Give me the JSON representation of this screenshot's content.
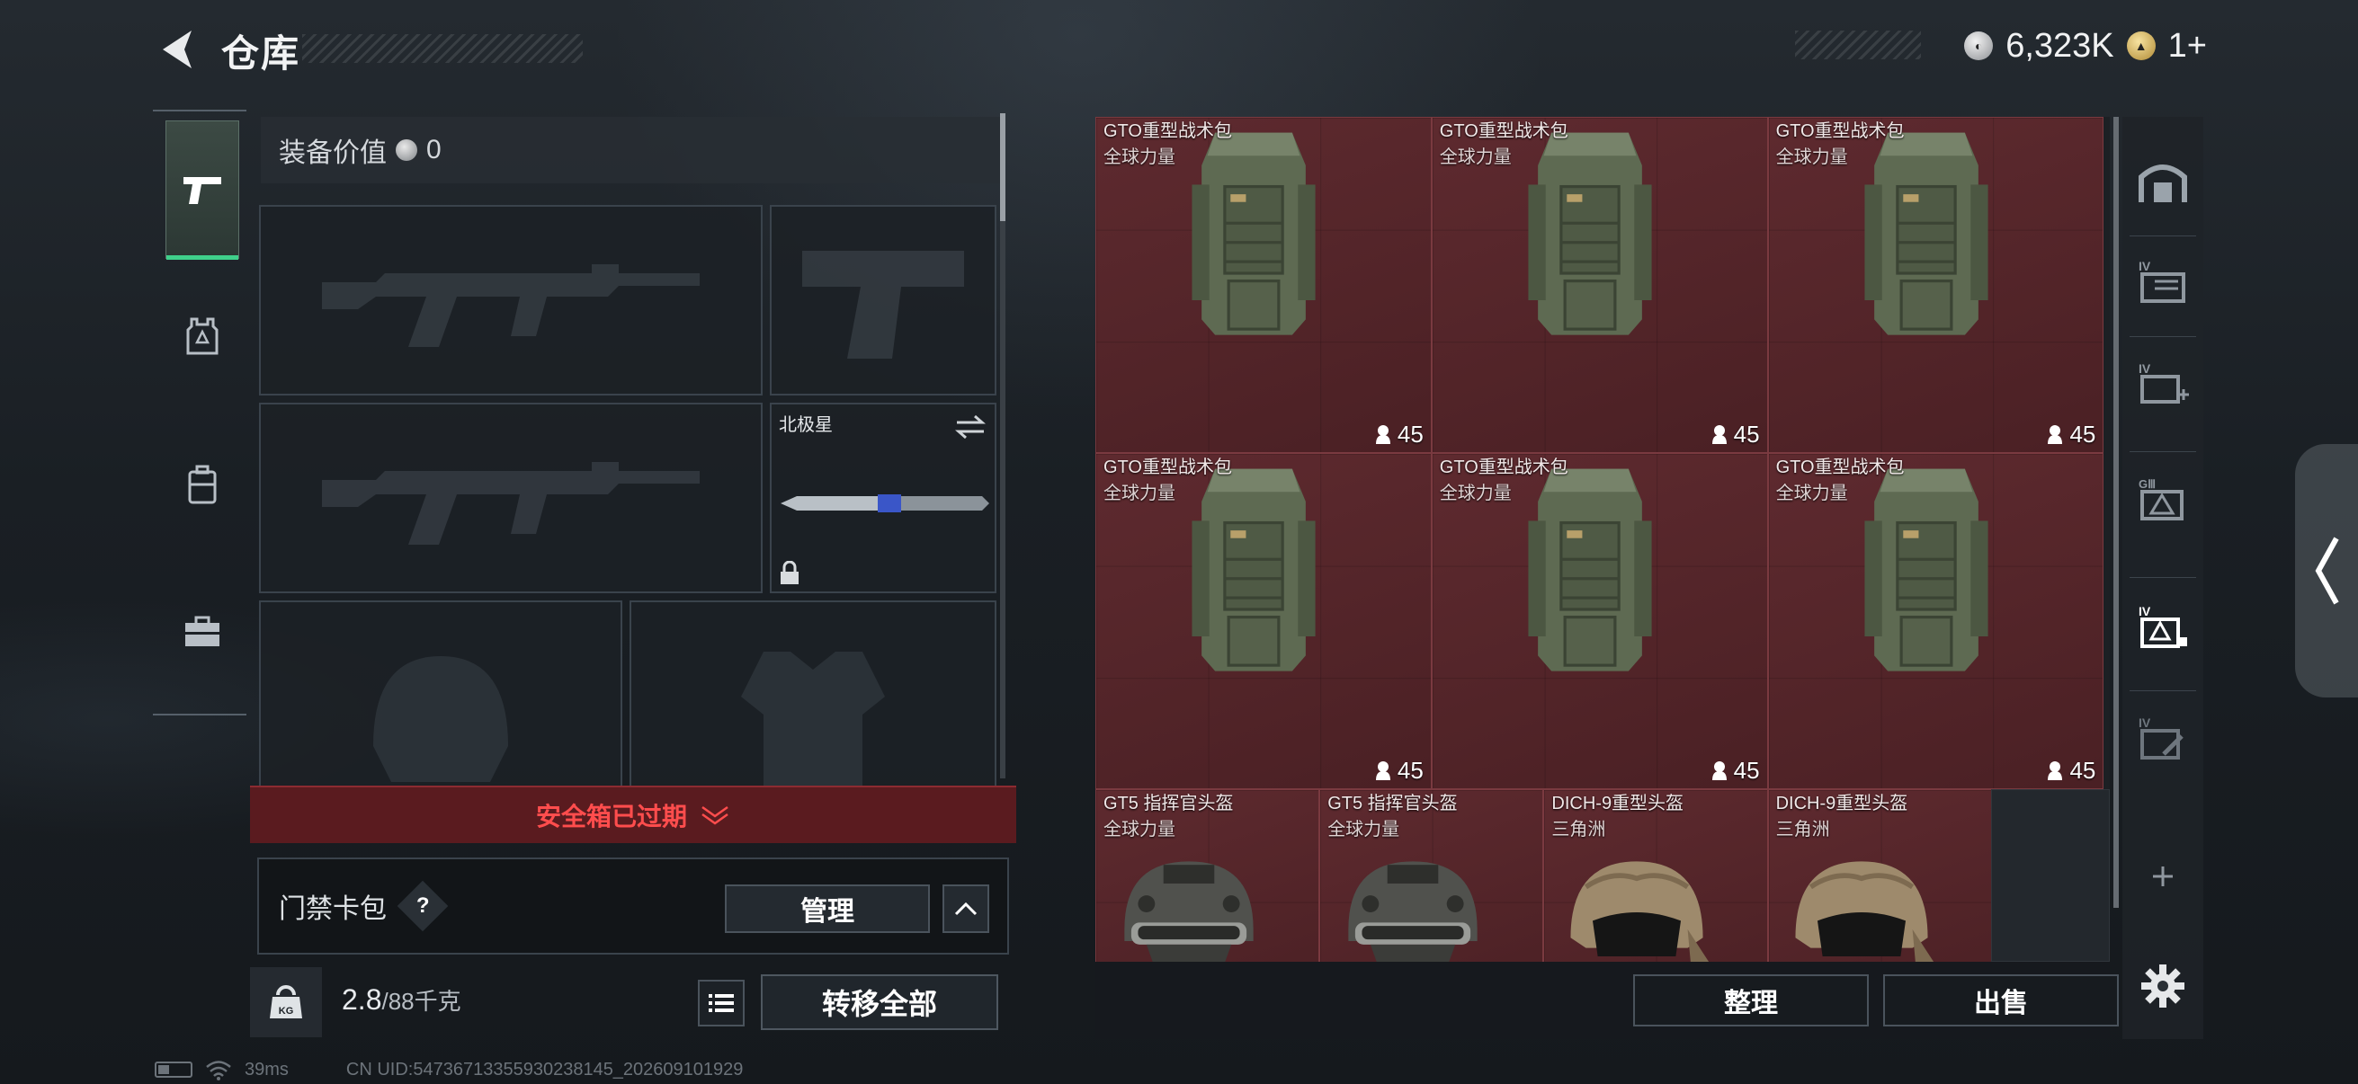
{
  "header": {
    "title": "仓库"
  },
  "currency": [
    {
      "icon": "silver-coin-icon",
      "value": "6,323K"
    },
    {
      "icon": "gold-coin-icon",
      "value": "1+"
    }
  ],
  "left_nav": {
    "items": [
      {
        "name": "weapons",
        "icon": "pistol-icon",
        "active": true
      },
      {
        "name": "armor",
        "icon": "armor-icon",
        "active": false
      },
      {
        "name": "backpack",
        "icon": "backpack-icon",
        "active": false
      },
      {
        "name": "toolbox",
        "icon": "toolbox-icon",
        "active": false
      }
    ]
  },
  "equipment": {
    "value_label": "装备价值",
    "value": "0",
    "slots": [
      {
        "kind": "rifle-primary",
        "empty": true
      },
      {
        "kind": "pistol",
        "empty": true
      },
      {
        "kind": "rifle-secondary",
        "empty": true
      },
      {
        "kind": "melee",
        "label": "北极星",
        "empty": false,
        "locked": true
      },
      {
        "kind": "helmet",
        "empty": true
      },
      {
        "kind": "armor",
        "empty": true
      }
    ]
  },
  "safebox": {
    "status": "安全箱已过期"
  },
  "card_pack": {
    "label": "门禁卡包",
    "help": "?",
    "manage_label": "管理"
  },
  "weight": {
    "current": "2.8",
    "max_unit": "/88千克",
    "icon_label": "KG",
    "transfer_all_label": "转移全部"
  },
  "inventory": {
    "items": [
      {
        "name": "GTO重型战术包",
        "sub": "全球力量",
        "count": "45",
        "type": "backpack"
      },
      {
        "name": "GTO重型战术包",
        "sub": "全球力量",
        "count": "45",
        "type": "backpack"
      },
      {
        "name": "GTO重型战术包",
        "sub": "全球力量",
        "count": "45",
        "type": "backpack"
      },
      {
        "name": "GTO重型战术包",
        "sub": "全球力量",
        "count": "45",
        "type": "backpack"
      },
      {
        "name": "GTO重型战术包",
        "sub": "全球力量",
        "count": "45",
        "type": "backpack"
      },
      {
        "name": "GTO重型战术包",
        "sub": "全球力量",
        "count": "45",
        "type": "backpack"
      },
      {
        "name": "GT5 指挥官头盔",
        "sub": "全球力量",
        "type": "helmet-dark"
      },
      {
        "name": "GT5 指挥官头盔",
        "sub": "全球力量",
        "type": "helmet-dark"
      },
      {
        "name": "DICH-9重型头盔",
        "sub": "三角洲",
        "type": "helmet-tan"
      },
      {
        "name": "DICH-9重型头盔",
        "sub": "三角洲",
        "type": "helmet-tan"
      }
    ],
    "sort_label": "整理",
    "sell_label": "出售"
  },
  "right_nav": {
    "tabs": [
      {
        "icon": "safe-house-icon"
      },
      {
        "icon": "storage-iv-icon",
        "level": "IV"
      },
      {
        "icon": "storage-add-icon",
        "level": "IV"
      },
      {
        "icon": "storage-g-icon",
        "level": "GⅢ"
      },
      {
        "icon": "storage-locked-icon",
        "level": "IV"
      },
      {
        "icon": "storage-edit-icon",
        "level": "IV"
      }
    ]
  },
  "status_bar": {
    "ping": "39ms",
    "uid": "CN UID:5473671335593023814​5_202609101929"
  },
  "colors": {
    "item_bg": "#5e2a2f",
    "accent_green": "#3fd08a",
    "danger_red": "#ff4d4d",
    "banner_bg": "#5a1b1f"
  }
}
